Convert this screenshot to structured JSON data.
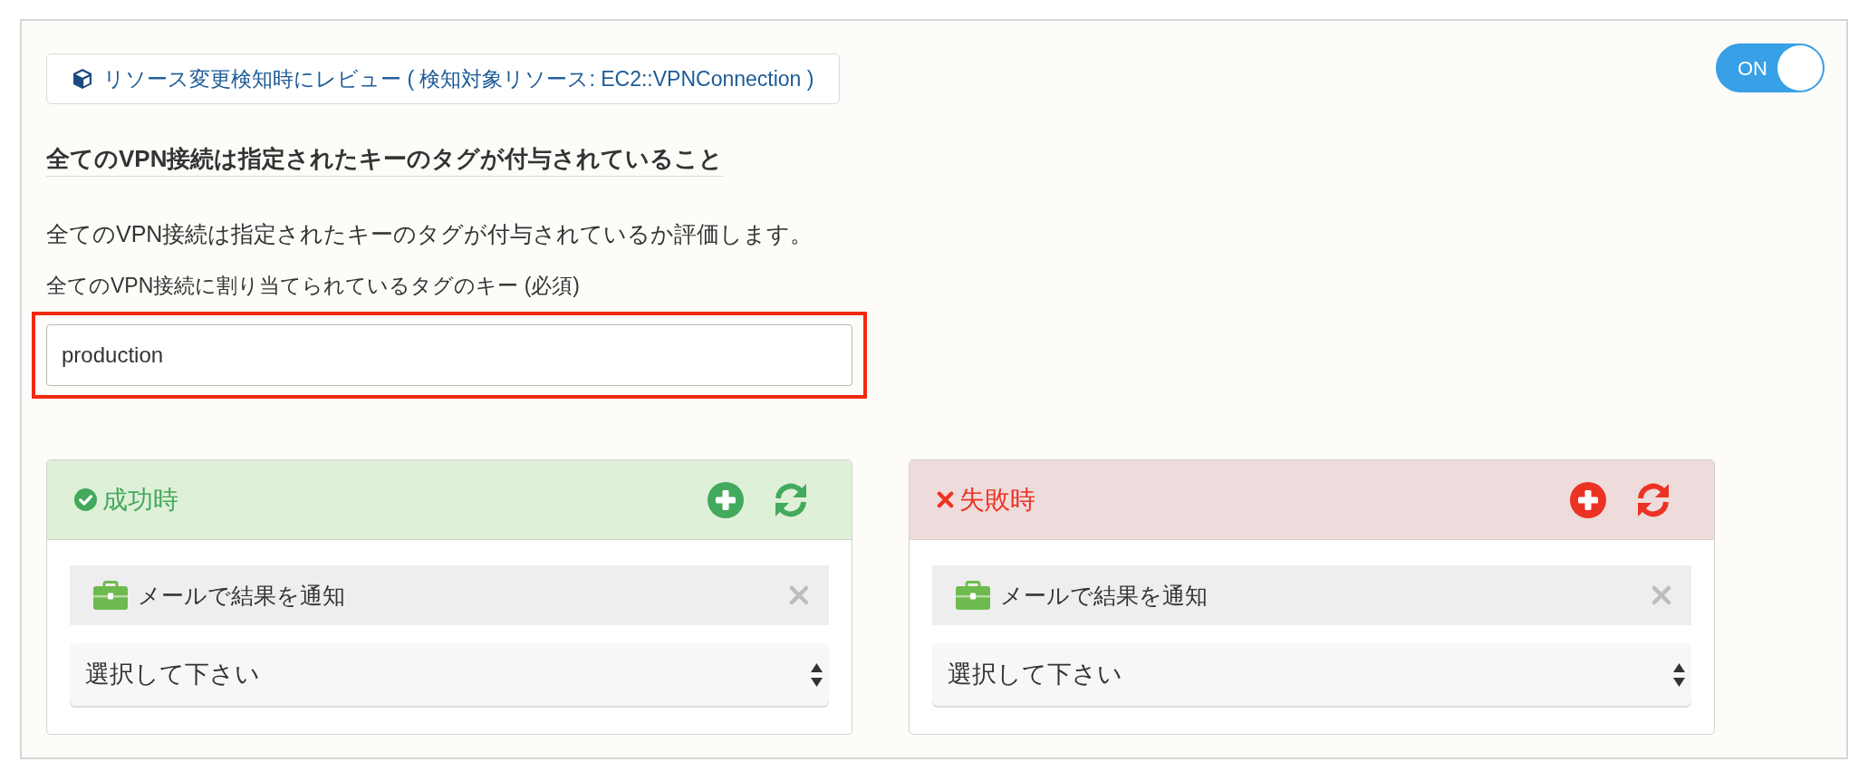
{
  "trigger": {
    "text": "リソース変更検知時にレビュー ( 検知対象リソース: EC2::VPNConnection )"
  },
  "toggle": {
    "label": "ON",
    "on": true
  },
  "rule": {
    "title": "全てのVPN接続は指定されたキーのタグが付与されていること",
    "description": "全てのVPN接続は指定されたキーのタグが付与されているか評価します。",
    "field_label": "全てのVPN接続に割り当てられているタグのキー (必須)",
    "field_value": "production",
    "highlighted": true
  },
  "panels": [
    {
      "kind": "success",
      "title": "成功時",
      "actions": [
        {
          "label": "メールで結果を通知"
        }
      ],
      "select": {
        "placeholder": "選択して下さい"
      }
    },
    {
      "kind": "failure",
      "title": "失敗時",
      "actions": [
        {
          "label": "メールで結果を通知"
        }
      ],
      "select": {
        "placeholder": "選択して下さい"
      }
    }
  ]
}
